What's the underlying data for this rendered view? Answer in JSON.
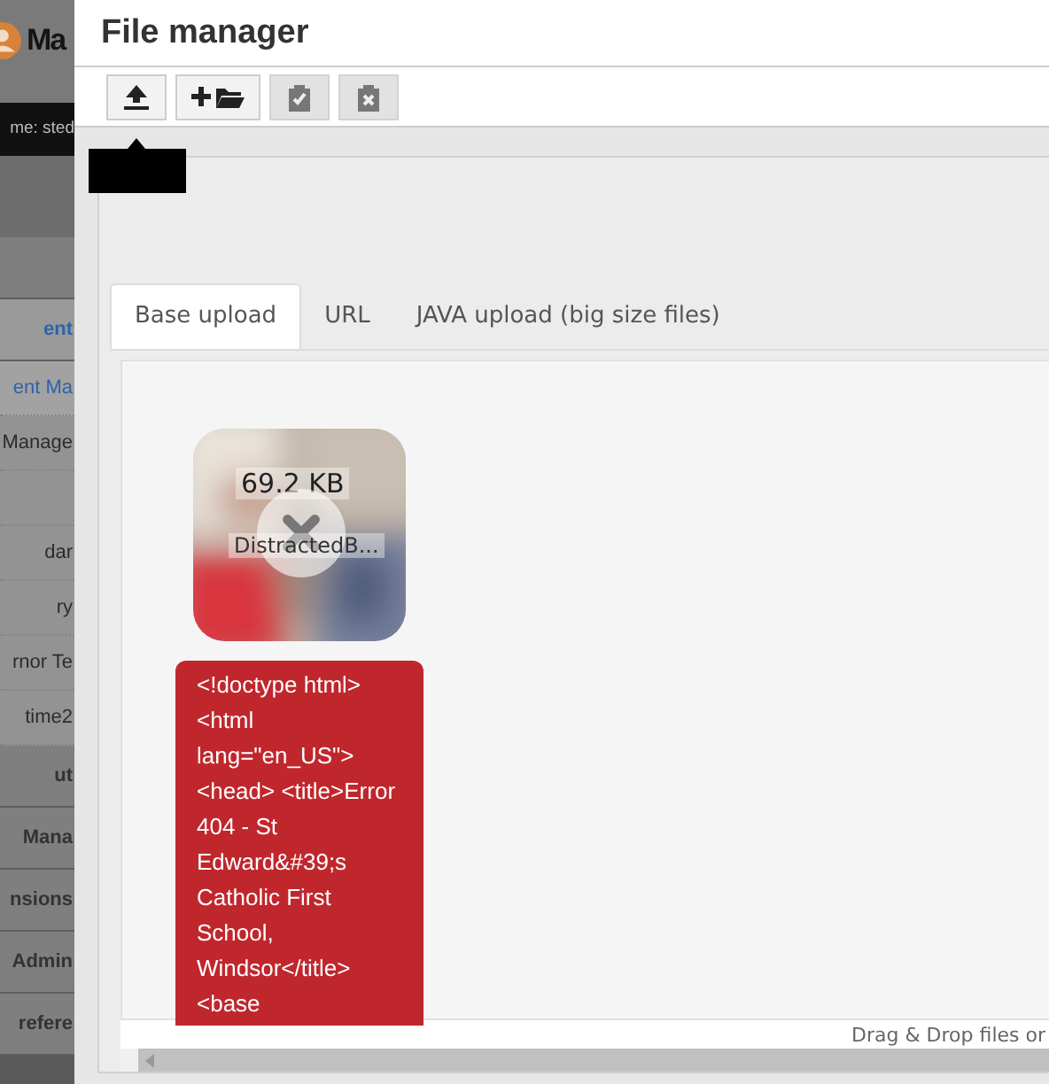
{
  "sidebar": {
    "logo_text": "Ma",
    "user": "me: sted",
    "items": [
      {
        "kind": "spacer-section"
      },
      {
        "label": "ent",
        "kind": "section",
        "selected": true
      },
      {
        "label": "ent Ma",
        "kind": "link",
        "selected": true
      },
      {
        "label": "Manage",
        "kind": "link",
        "selected": false
      },
      {
        "kind": "spacer-link"
      },
      {
        "label": "dar",
        "kind": "link",
        "selected": false
      },
      {
        "label": "ry",
        "kind": "link",
        "selected": false
      },
      {
        "label": "rnor Te",
        "kind": "link",
        "selected": false
      },
      {
        "label": "time2",
        "kind": "link",
        "selected": false
      },
      {
        "label": "ut",
        "kind": "section",
        "selected": false
      },
      {
        "label": "Mana",
        "kind": "section",
        "selected": false
      },
      {
        "label": "nsions",
        "kind": "section",
        "selected": false
      },
      {
        "label": "Admin",
        "kind": "section",
        "selected": false
      },
      {
        "label": "refere",
        "kind": "section",
        "selected": false
      }
    ]
  },
  "window": {
    "title": "File manager"
  },
  "toolbar": [
    {
      "kind": "upload",
      "disabled": false
    },
    {
      "kind": "new-folder",
      "disabled": false
    },
    {
      "kind": "paste",
      "disabled": true
    },
    {
      "kind": "clear",
      "disabled": true
    }
  ],
  "tabs": [
    {
      "label": "Base upload",
      "selected": true
    },
    {
      "label": "URL",
      "selected": false
    },
    {
      "label": "JAVA upload (big size files)",
      "selected": false
    }
  ],
  "upload": {
    "size": "69.2 KB",
    "name": "DistractedB...",
    "error": "<!doctype html> <html lang=\"en_US\"> <head> <title>Error 404 - St Edward&#39;s Catholic First School, Windsor</title> <base"
  },
  "footer": "Drag & Drop files or"
}
